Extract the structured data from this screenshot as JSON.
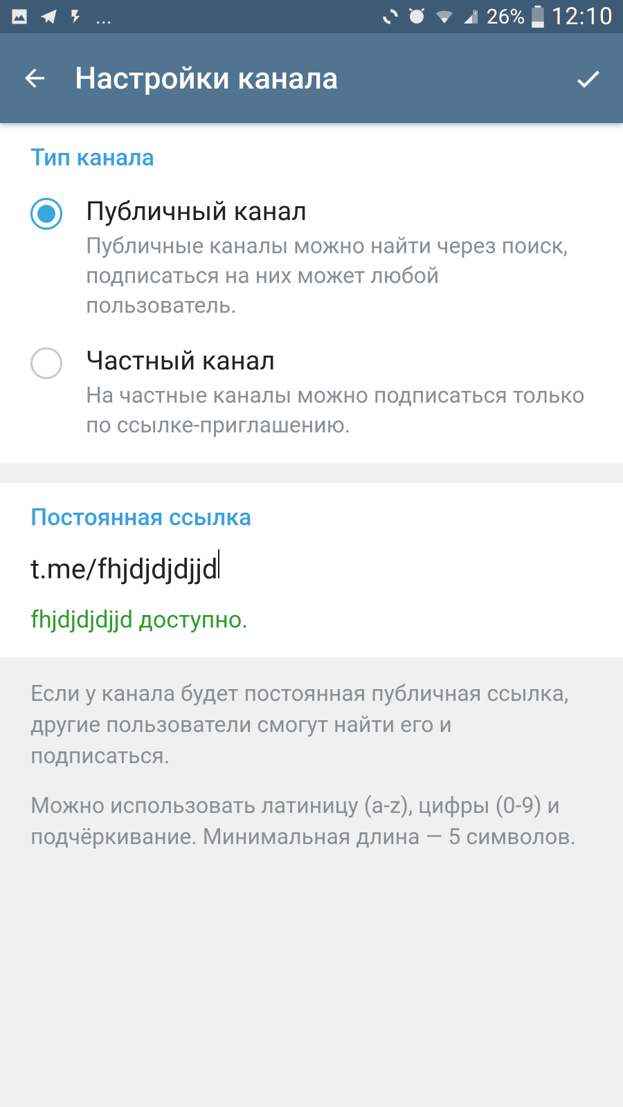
{
  "status": {
    "battery_pct": "26%",
    "time": "12:10",
    "ellipsis": "..."
  },
  "header": {
    "title": "Настройки канала"
  },
  "type_section": {
    "header": "Тип канала",
    "options": [
      {
        "title": "Публичный канал",
        "desc": "Публичные каналы можно найти через поиск, подписаться на них может любой пользователь.",
        "selected": true
      },
      {
        "title": "Частный канал",
        "desc": "На частные каналы можно подписаться только по ссылке-приглашению.",
        "selected": false
      }
    ]
  },
  "link_section": {
    "header": "Постоянная ссылка",
    "prefix": "t.me/",
    "value": "fhjdjdjdjjd",
    "availability": "fhjdjdjdjjd доступно."
  },
  "info": {
    "p1": "Если у канала будет постоянная публичная ссылка, другие пользователи смогут найти его и подписаться.",
    "p2": "Можно использовать латиницу (a-z), цифры (0-9) и подчёркивание. Минимальная длина — 5 символов."
  }
}
